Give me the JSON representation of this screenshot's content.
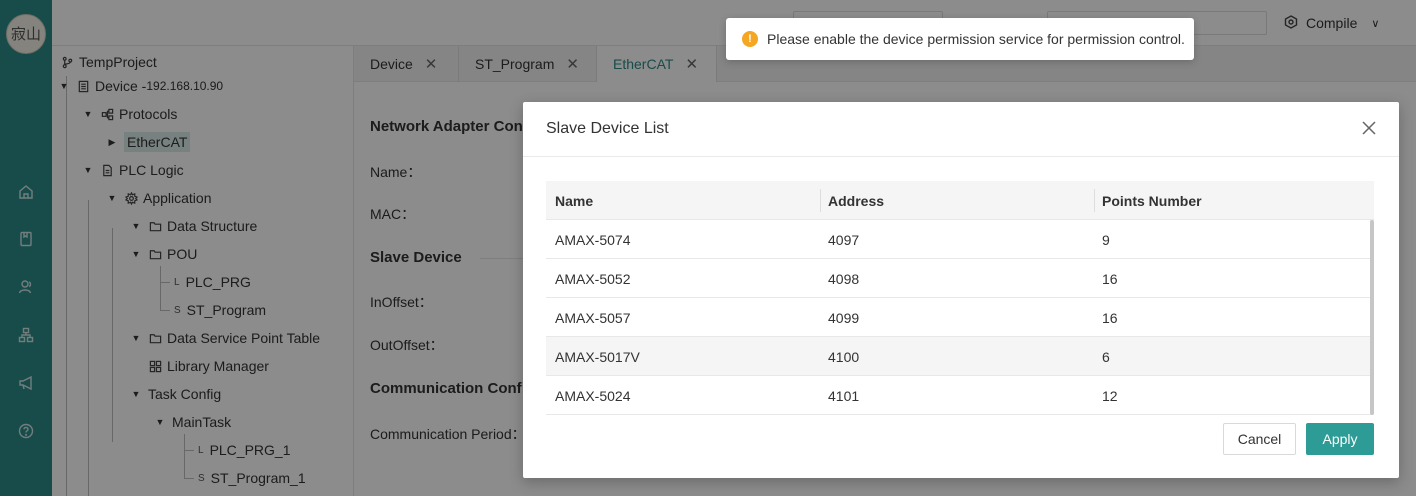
{
  "logo": {
    "text": "寂山"
  },
  "rail": {
    "icons": [
      "home-icon",
      "document-icon",
      "users-icon",
      "org-chart-icon",
      "megaphone-icon",
      "help-icon"
    ]
  },
  "topbar": {
    "compile_label": "Compile"
  },
  "tree": {
    "project": "TempProject",
    "device": "Device - ",
    "device_ip": "192.168.10.90",
    "protocols": "Protocols",
    "ethercat": "EtherCAT",
    "plc_logic": "PLC Logic",
    "application": "Application",
    "data_structure": "Data Structure",
    "pou": "POU",
    "plc_prg": "PLC_PRG",
    "plc_prg_mark": "L",
    "st_program": "ST_Program",
    "st_program_mark": "S",
    "data_service": "Data Service Point Table",
    "library_manager": "Library Manager",
    "task_config": "Task Config",
    "main_task": "MainTask",
    "plc_prg_1": "PLC_PRG_1",
    "plc_prg_1_mark": "L",
    "st_program_1": "ST_Program_1",
    "st_program_1_mark": "S"
  },
  "tabs": [
    {
      "label": "Device",
      "close": "✕"
    },
    {
      "label": "ST_Program",
      "close": "✕"
    },
    {
      "label": "EtherCAT",
      "close": "✕"
    }
  ],
  "editor": {
    "network_adapter": "Network Adapter Con",
    "name_label": "Name：",
    "mac_label": "MAC：",
    "slave_device": "Slave Device",
    "in_offset": "InOffset：",
    "out_offset": "OutOffset：",
    "communication": "Communication Conf",
    "comm_period": "Communication Period："
  },
  "toast": {
    "icon": "!",
    "message": "Please enable the device permission service for permission control."
  },
  "modal": {
    "title": "Slave Device List",
    "columns": [
      "Name",
      "Address",
      "Points Number"
    ],
    "rows": [
      {
        "name": "AMAX-5074",
        "address": "4097",
        "points": "9"
      },
      {
        "name": "AMAX-5052",
        "address": "4098",
        "points": "16"
      },
      {
        "name": "AMAX-5057",
        "address": "4099",
        "points": "16"
      },
      {
        "name": "AMAX-5017V",
        "address": "4100",
        "points": "6"
      },
      {
        "name": "AMAX-5024",
        "address": "4101",
        "points": "12"
      }
    ],
    "cancel_label": "Cancel",
    "apply_label": "Apply"
  },
  "colors": {
    "accent": "#2d8a87",
    "apply": "#2d9b96",
    "warning": "#f5a623"
  }
}
